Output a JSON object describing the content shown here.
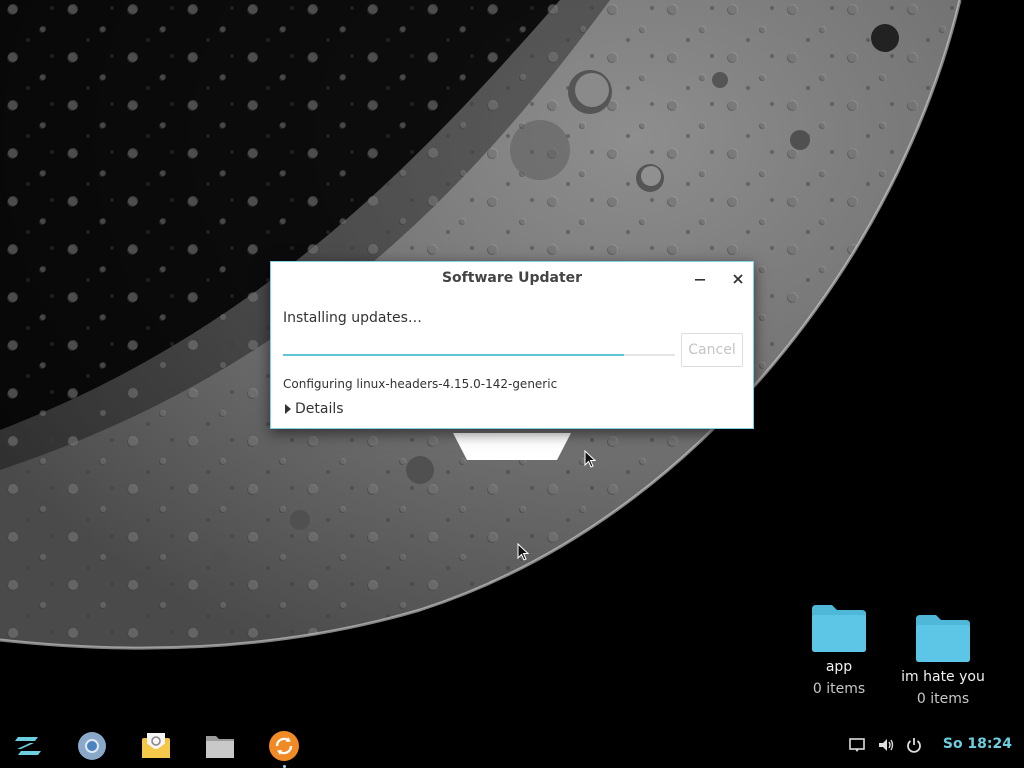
{
  "dialog": {
    "title": "Software Updater",
    "status": "Installing updates…",
    "progress_percent": 87,
    "cancel_label": "Cancel",
    "configuring": "Configuring linux-headers-4.15.0-142-generic",
    "details_label": "Details"
  },
  "desktop": {
    "icons": [
      {
        "name": "app",
        "count": "0 items"
      },
      {
        "name": "im hate you",
        "count": "0 items"
      }
    ]
  },
  "taskbar": {
    "apps": [
      {
        "name": "zorin-menu-icon"
      },
      {
        "name": "chromium-icon"
      },
      {
        "name": "mail-icon"
      },
      {
        "name": "files-icon"
      },
      {
        "name": "software-updater-icon"
      }
    ],
    "clock": "So 18:24"
  },
  "colors": {
    "accent": "#5fc6d8",
    "folder": "#5dc6e6",
    "updater_orange": "#f08a24"
  }
}
